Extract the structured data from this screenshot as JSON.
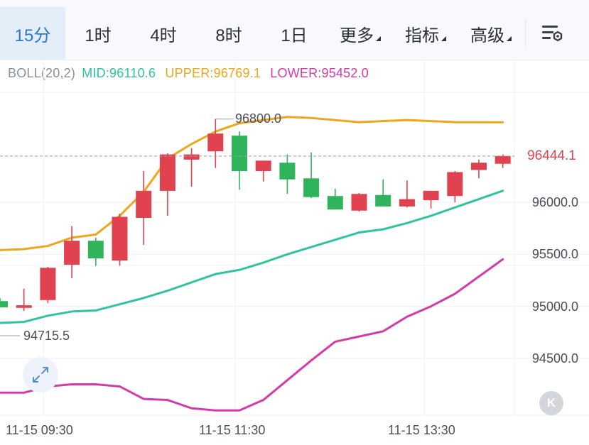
{
  "tabs": [
    {
      "label": "15分",
      "active": true,
      "dropdown": false
    },
    {
      "label": "1时",
      "active": false,
      "dropdown": false
    },
    {
      "label": "4时",
      "active": false,
      "dropdown": false
    },
    {
      "label": "8时",
      "active": false,
      "dropdown": false
    },
    {
      "label": "1日",
      "active": false,
      "dropdown": false
    },
    {
      "label": "更多",
      "active": false,
      "dropdown": true
    },
    {
      "label": "指标",
      "active": false,
      "dropdown": true
    },
    {
      "label": "高级",
      "active": false,
      "dropdown": true
    }
  ],
  "settings_icon": "chart-settings-icon",
  "indicator": {
    "name": "BOLL(20,2)",
    "mid": "MID:96110.6",
    "upper": "UPPER:96769.1",
    "lower": "LOWER:95452.0"
  },
  "price_axis": [
    "96000.0",
    "95500.0",
    "95000.0",
    "94500.0"
  ],
  "current_price": "96444.1",
  "high_label": "96800.0",
  "low_label": "94715.5",
  "time_labels": [
    "11-15 09:30",
    "11-15 11:30",
    "11-15 13:30"
  ],
  "expand_icon": "expand-arrows-icon",
  "kline_badge": "K",
  "colors": {
    "up": "#e0424f",
    "down": "#2fb35b",
    "mid": "#2ec4a0",
    "upper": "#f0a61a",
    "lower": "#d63aa8",
    "accent": "#2f74d0"
  },
  "chart_data": {
    "type": "candlestick",
    "x_labels": [
      "11-15 09:30",
      "11-15 11:30",
      "11-15 13:30"
    ],
    "candles": [
      {
        "o": 95050,
        "h": 95080,
        "l": 94990,
        "c": 94990
      },
      {
        "o": 94985,
        "h": 95170,
        "l": 94955,
        "c": 95010
      },
      {
        "o": 95060,
        "h": 95380,
        "l": 95030,
        "c": 95370
      },
      {
        "o": 95400,
        "h": 95770,
        "l": 95270,
        "c": 95630
      },
      {
        "o": 95630,
        "h": 95660,
        "l": 95390,
        "c": 95460
      },
      {
        "o": 95440,
        "h": 95890,
        "l": 95390,
        "c": 95860
      },
      {
        "o": 95850,
        "h": 96300,
        "l": 95590,
        "c": 96110
      },
      {
        "o": 96110,
        "h": 96470,
        "l": 95870,
        "c": 96460
      },
      {
        "o": 96410,
        "h": 96520,
        "l": 96150,
        "c": 96460
      },
      {
        "o": 96490,
        "h": 96800,
        "l": 96330,
        "c": 96660
      },
      {
        "o": 96640,
        "h": 96680,
        "l": 96120,
        "c": 96300
      },
      {
        "o": 96300,
        "h": 96380,
        "l": 96200,
        "c": 96400
      },
      {
        "o": 96380,
        "h": 96460,
        "l": 96080,
        "c": 96220
      },
      {
        "o": 96230,
        "h": 96480,
        "l": 96040,
        "c": 96050
      },
      {
        "o": 96060,
        "h": 96130,
        "l": 95930,
        "c": 95930
      },
      {
        "o": 95920,
        "h": 96090,
        "l": 95910,
        "c": 96080
      },
      {
        "o": 96070,
        "h": 96220,
        "l": 95960,
        "c": 95960
      },
      {
        "o": 95960,
        "h": 96210,
        "l": 95950,
        "c": 96030
      },
      {
        "o": 96020,
        "h": 96100,
        "l": 95940,
        "c": 96110
      },
      {
        "o": 96060,
        "h": 96300,
        "l": 96000,
        "c": 96290
      },
      {
        "o": 96310,
        "h": 96410,
        "l": 96230,
        "c": 96380
      },
      {
        "o": 96370,
        "h": 96460,
        "l": 96330,
        "c": 96444.1
      }
    ],
    "series": [
      {
        "name": "UPPER",
        "values": [
          95540,
          95550,
          95580,
          95660,
          95690,
          95870,
          96100,
          96420,
          96560,
          96680,
          96760,
          96790,
          96820,
          96810,
          96790,
          96770,
          96780,
          96790,
          96780,
          96770,
          96769.1
        ]
      },
      {
        "name": "MID",
        "values": [
          94840,
          94850,
          94910,
          94950,
          94960,
          95020,
          95080,
          95150,
          95230,
          95310,
          95350,
          95420,
          95500,
          95570,
          95640,
          95710,
          95740,
          95800,
          95870,
          95950,
          96110.6
        ]
      },
      {
        "name": "LOWER",
        "values": [
          94170,
          94170,
          94230,
          94250,
          94250,
          94230,
          94110,
          94100,
          94020,
          94000,
          94000,
          94100,
          94290,
          94480,
          94660,
          94710,
          94760,
          94900,
          95000,
          95120,
          95452.0
        ]
      }
    ],
    "x_indices": [
      0,
      1,
      2,
      3,
      4,
      5,
      6,
      7,
      8,
      9,
      10,
      11,
      12,
      13,
      14,
      15,
      16,
      17,
      18,
      19,
      21
    ],
    "y_ticks": [
      94500,
      95000,
      95500,
      96000
    ],
    "current_price": 96444.1,
    "high": 96800.0,
    "low": 94715.5,
    "grid": true
  }
}
